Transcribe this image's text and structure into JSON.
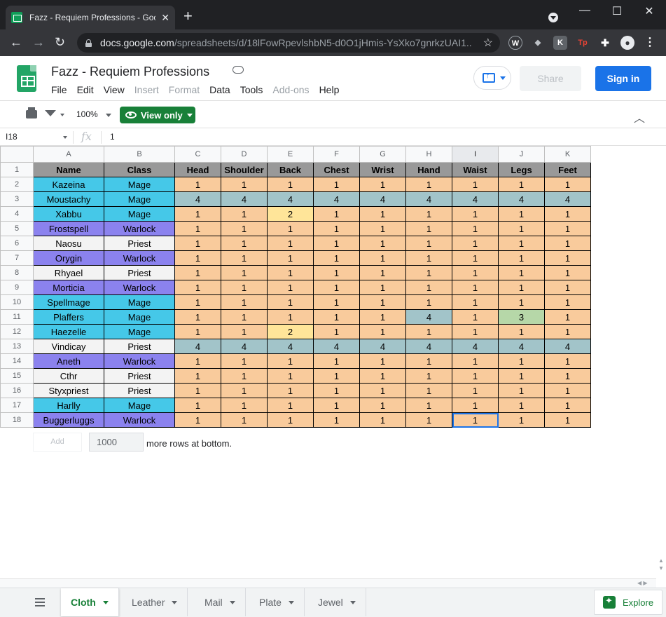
{
  "browser": {
    "tab_title": "Fazz - Requiem Professions - Goo",
    "tab_close": "✕",
    "new_tab": "+",
    "url_host": "docs.google.com",
    "url_path": "/spreadsheets/d/18lFowRpevlshbN5-d0O1jHmis-YsXko7gnrkzUAI1...",
    "extensions": [
      {
        "label": "W",
        "color": "#5f6368"
      },
      {
        "label": "◆",
        "color": "#5f6368"
      },
      {
        "label": "K",
        "color": "#5f6368"
      },
      {
        "label": "Tp",
        "color": "#c5221f"
      }
    ],
    "win_minimize": "—",
    "win_maximize": "☐",
    "win_close": "✕"
  },
  "app": {
    "doc_title": "Fazz - Requiem Professions",
    "menu": [
      "File",
      "Edit",
      "View",
      "Insert",
      "Format",
      "Data",
      "Tools",
      "Add-ons",
      "Help"
    ],
    "share_label": "Share",
    "signin_label": "Sign in"
  },
  "toolbar": {
    "zoom": "100%",
    "view_only": "View only"
  },
  "formula_bar": {
    "cell_ref": "I18",
    "fx": "fx",
    "value": "1"
  },
  "sheet": {
    "columns": [
      "A",
      "B",
      "C",
      "D",
      "E",
      "F",
      "G",
      "H",
      "I",
      "J",
      "K"
    ],
    "selected_column": "I",
    "headers": [
      "Name",
      "Class",
      "Head",
      "Shoulder",
      "Back",
      "Chest",
      "Wrist",
      "Hand",
      "Waist",
      "Legs",
      "Feet"
    ],
    "rows": [
      {
        "name": "Kazeina",
        "class": "Mage",
        "vals": [
          1,
          1,
          1,
          1,
          1,
          1,
          1,
          1,
          1
        ]
      },
      {
        "name": "Moustachy",
        "class": "Mage",
        "vals": [
          4,
          4,
          4,
          4,
          4,
          4,
          4,
          4,
          4
        ]
      },
      {
        "name": "Xabbu",
        "class": "Mage",
        "vals": [
          1,
          1,
          2,
          1,
          1,
          1,
          1,
          1,
          1
        ]
      },
      {
        "name": "Frostspell",
        "class": "Warlock",
        "vals": [
          1,
          1,
          1,
          1,
          1,
          1,
          1,
          1,
          1
        ]
      },
      {
        "name": "Naosu",
        "class": "Priest",
        "vals": [
          1,
          1,
          1,
          1,
          1,
          1,
          1,
          1,
          1
        ]
      },
      {
        "name": "Orygin",
        "class": "Warlock",
        "vals": [
          1,
          1,
          1,
          1,
          1,
          1,
          1,
          1,
          1
        ]
      },
      {
        "name": "Rhyael",
        "class": "Priest",
        "vals": [
          1,
          1,
          1,
          1,
          1,
          1,
          1,
          1,
          1
        ]
      },
      {
        "name": "Morticia",
        "class": "Warlock",
        "vals": [
          1,
          1,
          1,
          1,
          1,
          1,
          1,
          1,
          1
        ]
      },
      {
        "name": "Spellmage",
        "class": "Mage",
        "vals": [
          1,
          1,
          1,
          1,
          1,
          1,
          1,
          1,
          1
        ]
      },
      {
        "name": "Plaffers",
        "class": "Mage",
        "vals": [
          1,
          1,
          1,
          1,
          1,
          4,
          1,
          3,
          1
        ]
      },
      {
        "name": "Haezelle",
        "class": "Mage",
        "vals": [
          1,
          1,
          2,
          1,
          1,
          1,
          1,
          1,
          1
        ]
      },
      {
        "name": "Vindicay",
        "class": "Priest",
        "vals": [
          4,
          4,
          4,
          4,
          4,
          4,
          4,
          4,
          4
        ]
      },
      {
        "name": "Aneth",
        "class": "Warlock",
        "vals": [
          1,
          1,
          1,
          1,
          1,
          1,
          1,
          1,
          1
        ]
      },
      {
        "name": "Cthr",
        "class": "Priest",
        "vals": [
          1,
          1,
          1,
          1,
          1,
          1,
          1,
          1,
          1
        ]
      },
      {
        "name": "Styxpriest",
        "class": "Priest",
        "vals": [
          1,
          1,
          1,
          1,
          1,
          1,
          1,
          1,
          1
        ]
      },
      {
        "name": "Harlly",
        "class": "Mage",
        "vals": [
          1,
          1,
          1,
          1,
          1,
          1,
          1,
          1,
          1
        ]
      },
      {
        "name": "Buggerluggs",
        "class": "Warlock",
        "vals": [
          1,
          1,
          1,
          1,
          1,
          1,
          1,
          1,
          1
        ]
      }
    ],
    "value_colors": {
      "1": "#f9cb9c",
      "2": "#ffe599",
      "3": "#b6d7a8",
      "4": "#a2c4c9"
    },
    "class_colors": {
      "Mage": "#45c8e8",
      "Warlock": "#8b82ee",
      "Priest": "#f3f3f3"
    },
    "selected_cell": "I18",
    "add_label": "Add",
    "add_count": "1000",
    "more_rows_text": "more rows at bottom."
  },
  "tabs": {
    "sheets": [
      "Cloth",
      "Leather",
      "Mail",
      "Plate",
      "Jewel"
    ],
    "active": "Cloth",
    "explore_label": "Explore"
  }
}
